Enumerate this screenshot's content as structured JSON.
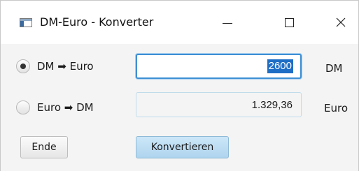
{
  "window": {
    "title": "DM-Euro - Konverter",
    "controls": {
      "minimize": "minimize",
      "maximize": "maximize",
      "close": "close"
    }
  },
  "converter": {
    "options": [
      {
        "label": "DM ➡ Euro",
        "selected": true
      },
      {
        "label": "Euro ➡ DM",
        "selected": false
      }
    ],
    "input": {
      "value": "2600",
      "unit": "DM"
    },
    "output": {
      "value": "1.329,36",
      "unit": "Euro"
    }
  },
  "buttons": {
    "end_label": "Ende",
    "convert_label": "Konvertieren"
  },
  "colors": {
    "focus_border": "#3d8fd4",
    "selection": "#1e6ec6",
    "convert_button": "#aed4ee"
  }
}
